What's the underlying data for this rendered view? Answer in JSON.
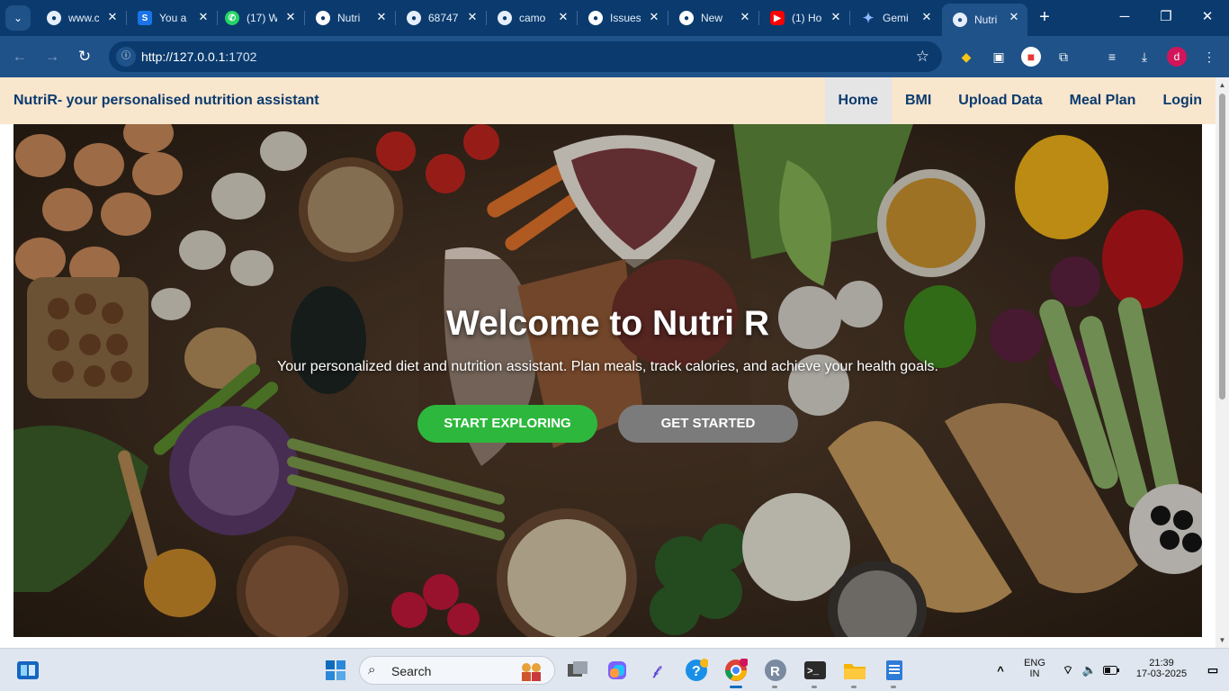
{
  "browser": {
    "tabs": [
      {
        "title": "www.c",
        "icon": "globe-icon",
        "active": false
      },
      {
        "title": "You a",
        "icon": "s-logo-icon",
        "active": false
      },
      {
        "title": "(17) W",
        "icon": "whatsapp-icon",
        "active": false
      },
      {
        "title": "Nutri",
        "icon": "github-icon",
        "active": false
      },
      {
        "title": "68747",
        "icon": "globe-icon",
        "active": false
      },
      {
        "title": "camo",
        "icon": "globe-icon",
        "active": false
      },
      {
        "title": "Issues",
        "icon": "github-icon",
        "active": false
      },
      {
        "title": "New",
        "icon": "github-icon",
        "active": false
      },
      {
        "title": "(1) Ho",
        "icon": "youtube-icon",
        "active": false
      },
      {
        "title": "Gemi",
        "icon": "gemini-icon",
        "active": false
      },
      {
        "title": "Nutri",
        "icon": "globe-icon",
        "active": true
      }
    ],
    "url_host": "http://127.0.0.1",
    "url_port": ":1702",
    "profile_initial": "d"
  },
  "site": {
    "brand": "NutriR- your personalised nutrition assistant",
    "nav": [
      "Home",
      "BMI",
      "Upload Data",
      "Meal Plan",
      "Login"
    ],
    "active_nav": "Home",
    "hero": {
      "title": "Welcome to Nutri R",
      "subtitle": "Your personalized diet and nutrition assistant. Plan meals, track calories, and achieve your health goals.",
      "primary_button": "START EXPLORING",
      "secondary_button": "GET STARTED"
    },
    "colors": {
      "header_bg": "#f8e6cd",
      "brand_text": "#0b3b6e",
      "primary_button": "#2db83d",
      "secondary_button": "#7b7b7b"
    }
  },
  "taskbar": {
    "search_label": "Search",
    "language": "ENG",
    "region": "IN",
    "time": "21:39",
    "date": "17-03-2025"
  }
}
